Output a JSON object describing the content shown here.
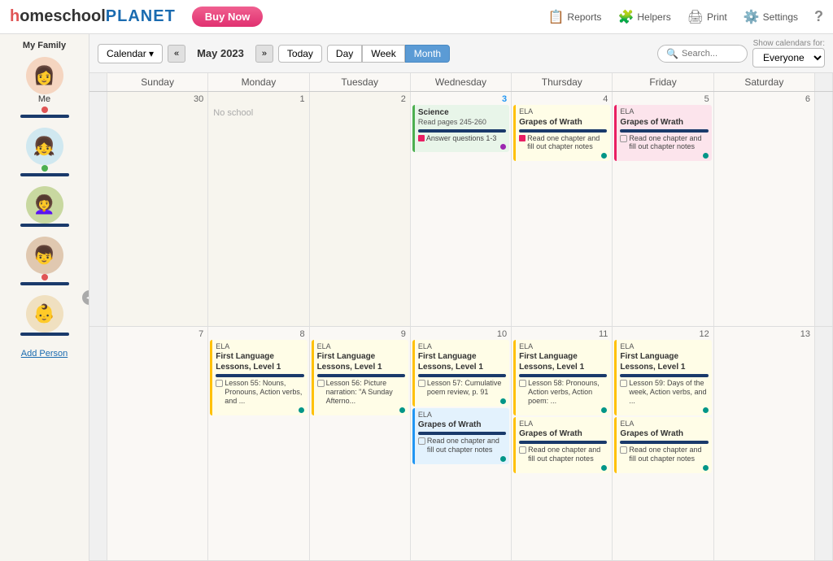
{
  "header": {
    "logo": {
      "home": "h",
      "school": "omeschool",
      "planet": "PLANET"
    },
    "buy_now": "Buy Now",
    "nav": {
      "reports": "Reports",
      "helpers": "Helpers",
      "print": "Print",
      "settings": "Settings",
      "help": "?"
    }
  },
  "sidebar": {
    "title": "My Family",
    "members": [
      {
        "name": "Me",
        "dot_color": "#e05555",
        "bar_color": "#1a3a6b",
        "avatar": "👩"
      },
      {
        "name": "",
        "dot_color": "#4caf50",
        "bar_color": "#1a3a6b",
        "avatar": "👧"
      },
      {
        "name": "",
        "dot_color": "",
        "bar_color": "#1a3a6b",
        "avatar": "👩‍🦱"
      },
      {
        "name": "",
        "dot_color": "#e05555",
        "bar_color": "#1a3a6b",
        "avatar": "👦"
      },
      {
        "name": "",
        "dot_color": "",
        "bar_color": "#1a3a6b",
        "avatar": "👶"
      }
    ],
    "add_person": "Add Person"
  },
  "toolbar": {
    "calendar_label": "Calendar ▾",
    "prev": "«",
    "next": "»",
    "month": "May 2023",
    "today": "Today",
    "day": "Day",
    "week": "Week",
    "month_view": "Month",
    "search_placeholder": "Search...",
    "show_calendars_for": "Show calendars for:",
    "everyone": "Everyone"
  },
  "calendar": {
    "day_headers": [
      "Sunday",
      "Monday",
      "Tuesday",
      "Wednesday",
      "Thursday",
      "Friday",
      "Saturday"
    ],
    "weeks": [
      {
        "days": [
          {
            "num": "30",
            "other_month": true,
            "events": []
          },
          {
            "num": "1",
            "no_school": true,
            "label": "No school",
            "events": []
          },
          {
            "num": "2",
            "events": []
          },
          {
            "num": "3",
            "events": [
              {
                "type": "green",
                "title": "Science",
                "desc": "Read pages 245-260",
                "bar": "navy",
                "tasks": [
                  {
                    "text": "Answer questions 1-3"
                  }
                ],
                "dot": "purple"
              }
            ]
          },
          {
            "num": "4",
            "events": [
              {
                "type": "yellow",
                "subject": "ELA",
                "title": "Grapes of Wrath",
                "bar": "navy",
                "tasks": [
                  {
                    "text": "Read one chapter and fill out chapter notes"
                  }
                ],
                "dot": "teal",
                "pink_sq": true
              }
            ]
          },
          {
            "num": "5",
            "events": [
              {
                "type": "pink",
                "subject": "ELA",
                "title": "Grapes of Wrath",
                "bar": "navy",
                "tasks": [
                  {
                    "text": "Read one chapter and fill out chapter notes"
                  }
                ],
                "dot": "teal"
              }
            ]
          },
          {
            "num": "6",
            "other_month": false,
            "events": []
          }
        ]
      },
      {
        "days": [
          {
            "num": "7",
            "events": []
          },
          {
            "num": "8",
            "events": [
              {
                "type": "yellow",
                "subject": "ELA",
                "title": "First Language Lessons, Level 1",
                "bar": "navy",
                "tasks": [
                  {
                    "text": "Lesson 55: Nouns, Pronouns, Action verbs, and ..."
                  }
                ],
                "dot": "teal"
              }
            ]
          },
          {
            "num": "9",
            "events": [
              {
                "type": "yellow",
                "subject": "ELA",
                "title": "First Language Lessons, Level 1",
                "bar": "navy",
                "tasks": [
                  {
                    "text": "Lesson 56: Picture narration: \"A Sunday Afterno..."
                  }
                ],
                "dot": "teal"
              }
            ]
          },
          {
            "num": "10",
            "events": [
              {
                "type": "yellow",
                "subject": "ELA",
                "title": "First Language Lessons, Level 1",
                "bar": "navy",
                "tasks": [
                  {
                    "text": "Lesson 57: Cumulative poem review, p. 91"
                  }
                ],
                "dot": "teal"
              },
              {
                "type": "blue",
                "subject": "ELA",
                "title": "Grapes of Wrath",
                "bar": "navy",
                "tasks": [
                  {
                    "text": "Read one chapter and fill out chapter notes"
                  }
                ],
                "dot": "teal"
              }
            ]
          },
          {
            "num": "11",
            "events": [
              {
                "type": "yellow",
                "subject": "ELA",
                "title": "First Language Lessons, Level 1",
                "bar": "navy",
                "tasks": [
                  {
                    "text": "Lesson 58: Pronouns, Action verbs, Action poem: ..."
                  }
                ],
                "dot": "teal"
              },
              {
                "type": "yellow",
                "subject": "ELA",
                "title": "Grapes of Wrath",
                "bar": "navy",
                "tasks": [
                  {
                    "text": "Read one chapter and fill out chapter notes"
                  }
                ],
                "dot": "teal"
              }
            ]
          },
          {
            "num": "12",
            "events": [
              {
                "type": "yellow",
                "subject": "ELA",
                "title": "First Language Lessons, Level 1",
                "bar": "navy",
                "tasks": [
                  {
                    "text": "Lesson 59: Days of the week, Action verbs, and ..."
                  }
                ],
                "dot": "teal"
              },
              {
                "type": "yellow",
                "subject": "ELA",
                "title": "Grapes of Wrath",
                "bar": "navy",
                "tasks": [
                  {
                    "text": "Read one chapter and fill out chapter notes"
                  }
                ],
                "dot": "teal"
              }
            ]
          },
          {
            "num": "13",
            "events": []
          }
        ]
      }
    ]
  }
}
